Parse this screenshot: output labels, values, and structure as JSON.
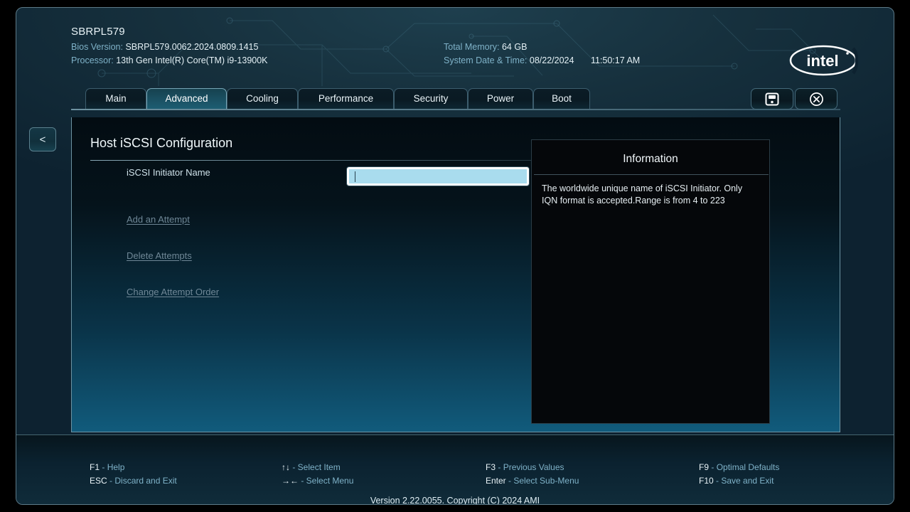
{
  "window": {
    "system_title": "SBRPL579",
    "header": {
      "bios_version_label": "Bios Version:",
      "bios_version_value": "SBRPL579.0062.2024.0809.1415",
      "processor_label": "Processor:",
      "processor_value": "13th Gen Intel(R) Core(TM) i9-13900K",
      "total_memory_label": "Total Memory:",
      "total_memory_value": "64 GB",
      "date_time_label": "System Date & Time:",
      "date_value": "08/22/2024",
      "time_value": "11:50:17 AM",
      "logo_text": "intel"
    }
  },
  "tabs": [
    {
      "label": "Main",
      "active": false
    },
    {
      "label": "Advanced",
      "active": true
    },
    {
      "label": "Cooling",
      "active": false
    },
    {
      "label": "Performance",
      "active": false
    },
    {
      "label": "Security",
      "active": false
    },
    {
      "label": "Power",
      "active": false
    },
    {
      "label": "Boot",
      "active": false
    }
  ],
  "toolbar": {
    "save_icon": "floppy-disk-icon",
    "close_icon": "circle-x-icon"
  },
  "nav": {
    "back_label": "<"
  },
  "main": {
    "page_title": "Host iSCSI Configuration",
    "field": {
      "label": "iSCSI Initiator Name",
      "value": "",
      "placeholder": ""
    },
    "links": [
      {
        "label": "Add an Attempt"
      },
      {
        "label": "Delete Attempts"
      },
      {
        "label": "Change Attempt Order"
      }
    ]
  },
  "information": {
    "title": "Information",
    "body": "The worldwide unique name of iSCSI Initiator. Only IQN format is accepted.Range is from 4 to 223"
  },
  "footer": {
    "hints": [
      {
        "key": "F1",
        "desc": "- Help"
      },
      {
        "key": "ESC",
        "desc": "- Discard and Exit"
      },
      {
        "key": "↑↓",
        "desc": "- Select Item"
      },
      {
        "key": "→←",
        "desc": "- Select Menu"
      },
      {
        "key": "F3",
        "desc": "- Previous Values"
      },
      {
        "key": "Enter",
        "desc": "- Select Sub-Menu"
      },
      {
        "key": "F9",
        "desc": "- Optimal Defaults"
      },
      {
        "key": "F10",
        "desc": "- Save and Exit"
      }
    ],
    "version": "Version 2.22.0055. Copyright (C) 2024 AMI"
  },
  "colors": {
    "accent_teal": "#1d5d72",
    "input_fill": "#a9dcee",
    "label_blue": "#7fb2c8",
    "link_dim": "#6f8796"
  }
}
